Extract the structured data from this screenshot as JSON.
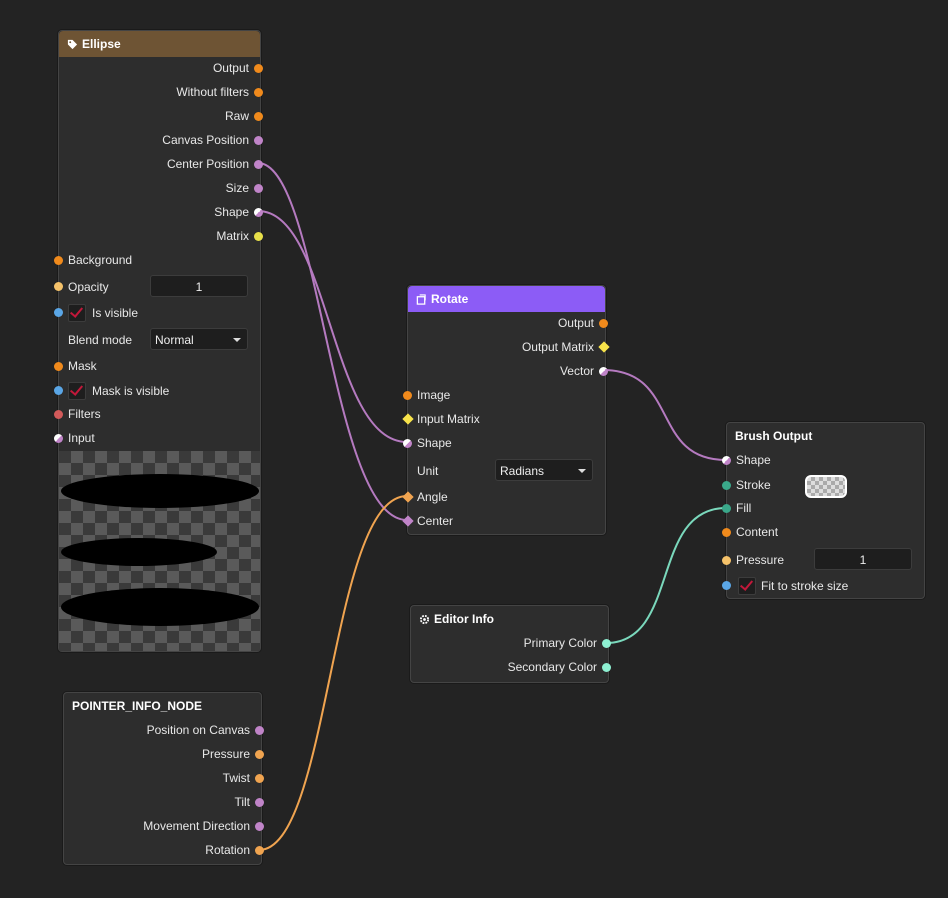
{
  "colors": {
    "canvas": "#232323",
    "ellipse_header": "#6e5434",
    "rotate_header": "#8c5cf6",
    "wire_shape": "#b57ac0",
    "wire_orange": "#f0a450",
    "wire_teal": "#7ad8bc"
  },
  "ellipse": {
    "title": "Ellipse",
    "icon": "tag-icon",
    "outputs": [
      "Output",
      "Without filters",
      "Raw",
      "Canvas Position",
      "Center Position",
      "Size",
      "Shape",
      "Matrix"
    ],
    "inputs": {
      "background": "Background",
      "opacity_label": "Opacity",
      "opacity_value": "1",
      "is_visible": "Is visible",
      "blend_mode_label": "Blend mode",
      "blend_mode_value": "Normal",
      "mask": "Mask",
      "mask_is_visible": "Mask is visible",
      "filters": "Filters",
      "input": "Input"
    }
  },
  "rotate": {
    "title": "Rotate",
    "icon": "rotate-icon",
    "outputs": [
      "Output",
      "Output Matrix",
      "Vector"
    ],
    "inputs": {
      "image": "Image",
      "input_matrix": "Input Matrix",
      "shape": "Shape",
      "unit_label": "Unit",
      "unit_value": "Radians",
      "angle": "Angle",
      "center": "Center"
    }
  },
  "brush_output": {
    "title": "Brush Output",
    "inputs": {
      "shape": "Shape",
      "stroke": "Stroke",
      "fill": "Fill",
      "content": "Content",
      "pressure_label": "Pressure",
      "pressure_value": "1",
      "fit_to_stroke": "Fit to stroke size"
    }
  },
  "editor_info": {
    "title": "Editor Info",
    "icon": "gear-icon",
    "outputs": [
      "Primary Color",
      "Secondary Color"
    ]
  },
  "pointer_info": {
    "title": "POINTER_INFO_NODE",
    "outputs": [
      "Position on Canvas",
      "Pressure",
      "Twist",
      "Tilt",
      "Movement Direction",
      "Rotation"
    ]
  }
}
